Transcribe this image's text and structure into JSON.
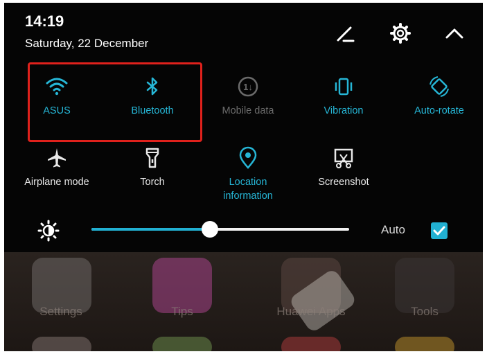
{
  "status": {
    "time": "14:19",
    "date": "Saturday, 22 December"
  },
  "header_icons": [
    "edit-icon",
    "settings-gear-icon",
    "collapse-chevron-up-icon"
  ],
  "tiles_row1": [
    {
      "label": "ASUS",
      "icon": "wifi-icon",
      "state": "on"
    },
    {
      "label": "Bluetooth",
      "icon": "bluetooth-icon",
      "state": "on"
    },
    {
      "label": "Mobile data",
      "icon": "mobile-data-icon",
      "state": "disabled"
    },
    {
      "label": "Vibration",
      "icon": "vibration-icon",
      "state": "on"
    },
    {
      "label": "Auto-rotate",
      "icon": "auto-rotate-icon",
      "state": "on"
    }
  ],
  "tiles_row2": [
    {
      "label": "Airplane mode",
      "icon": "airplane-icon",
      "state": "off"
    },
    {
      "label": "Torch",
      "icon": "torch-icon",
      "state": "off"
    },
    {
      "label": "Location\ninformation",
      "label_line1": "Location",
      "label_line2": "information",
      "icon": "location-icon",
      "state": "on"
    },
    {
      "label": "Screenshot",
      "icon": "screenshot-icon",
      "state": "off"
    }
  ],
  "brightness": {
    "level": 0.46,
    "auto_label": "Auto",
    "auto_checked": true
  },
  "home_apps": [
    "Settings",
    "Tips",
    "Huawei Apps",
    "Tools"
  ],
  "colors": {
    "accent": "#21b0d2",
    "highlight_box": "#e0211c",
    "panel_bg": "#050505"
  }
}
